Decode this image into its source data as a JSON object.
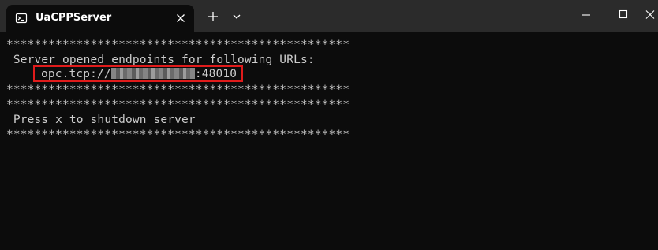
{
  "window": {
    "tab_title": "UaCPPServer"
  },
  "icons": {
    "tab_icon": "terminal-icon",
    "tab_close": "close-icon",
    "new_tab": "plus-icon",
    "dropdown": "chevron-down-icon",
    "minimize": "minimize-icon",
    "maximize": "maximize-icon",
    "close": "close-icon"
  },
  "colors": {
    "terminal_background": "#0c0c0c",
    "terminal_text": "#cccccc",
    "titlebar": "#2b2b2b",
    "highlight_box": "#e01b1b"
  },
  "terminal": {
    "lines": [
      "*************************************************",
      " Server opened endpoints for following URLs:",
      "*************************************************",
      "*************************************************",
      " Press x to shutdown server",
      "*************************************************"
    ],
    "url_prefix": "opc.tcp://",
    "url_suffix": ":48010"
  }
}
